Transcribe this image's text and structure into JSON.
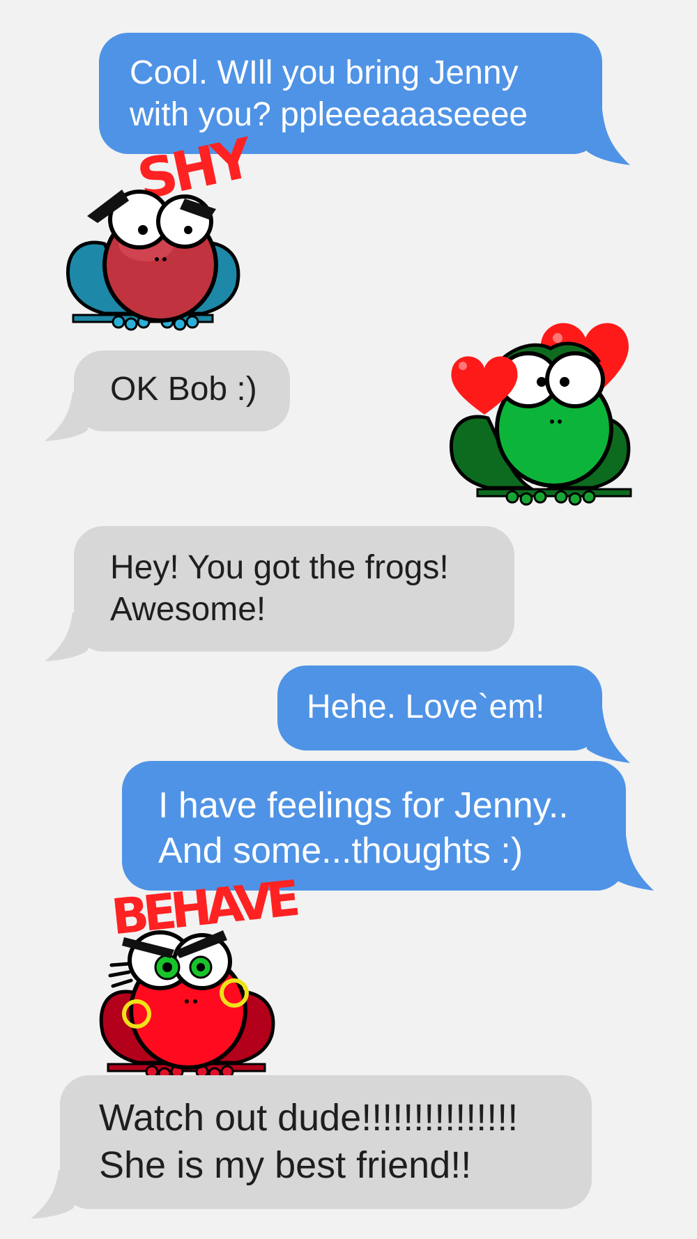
{
  "conversation": {
    "messages": [
      {
        "side": "sent",
        "text": "Cool. WIll you bring Jenny\nwith you? ppleeeaaaseeee"
      },
      {
        "side": "received",
        "text": "OK Bob :)"
      },
      {
        "side": "received",
        "text": "Hey! You got the frogs!\nAwesome!"
      },
      {
        "side": "sent",
        "text": "Hehe. Love`em!"
      },
      {
        "side": "sent",
        "text": "I have feelings for Jenny..\nAnd some...thoughts :)"
      },
      {
        "side": "received",
        "text": "Watch out dude!!!!!!!!!!!!!!!\nShe is my best friend!!"
      }
    ],
    "stickers": [
      {
        "icon": "shy-frog-icon",
        "caption": "SHY"
      },
      {
        "icon": "love-frog-icon"
      },
      {
        "icon": "behave-frog-icon",
        "caption": "BEHAVE"
      }
    ]
  },
  "colors": {
    "sent_bubble": "#4f93e6",
    "received_bubble": "#d7d7d7",
    "background": "#f2f2f2"
  }
}
